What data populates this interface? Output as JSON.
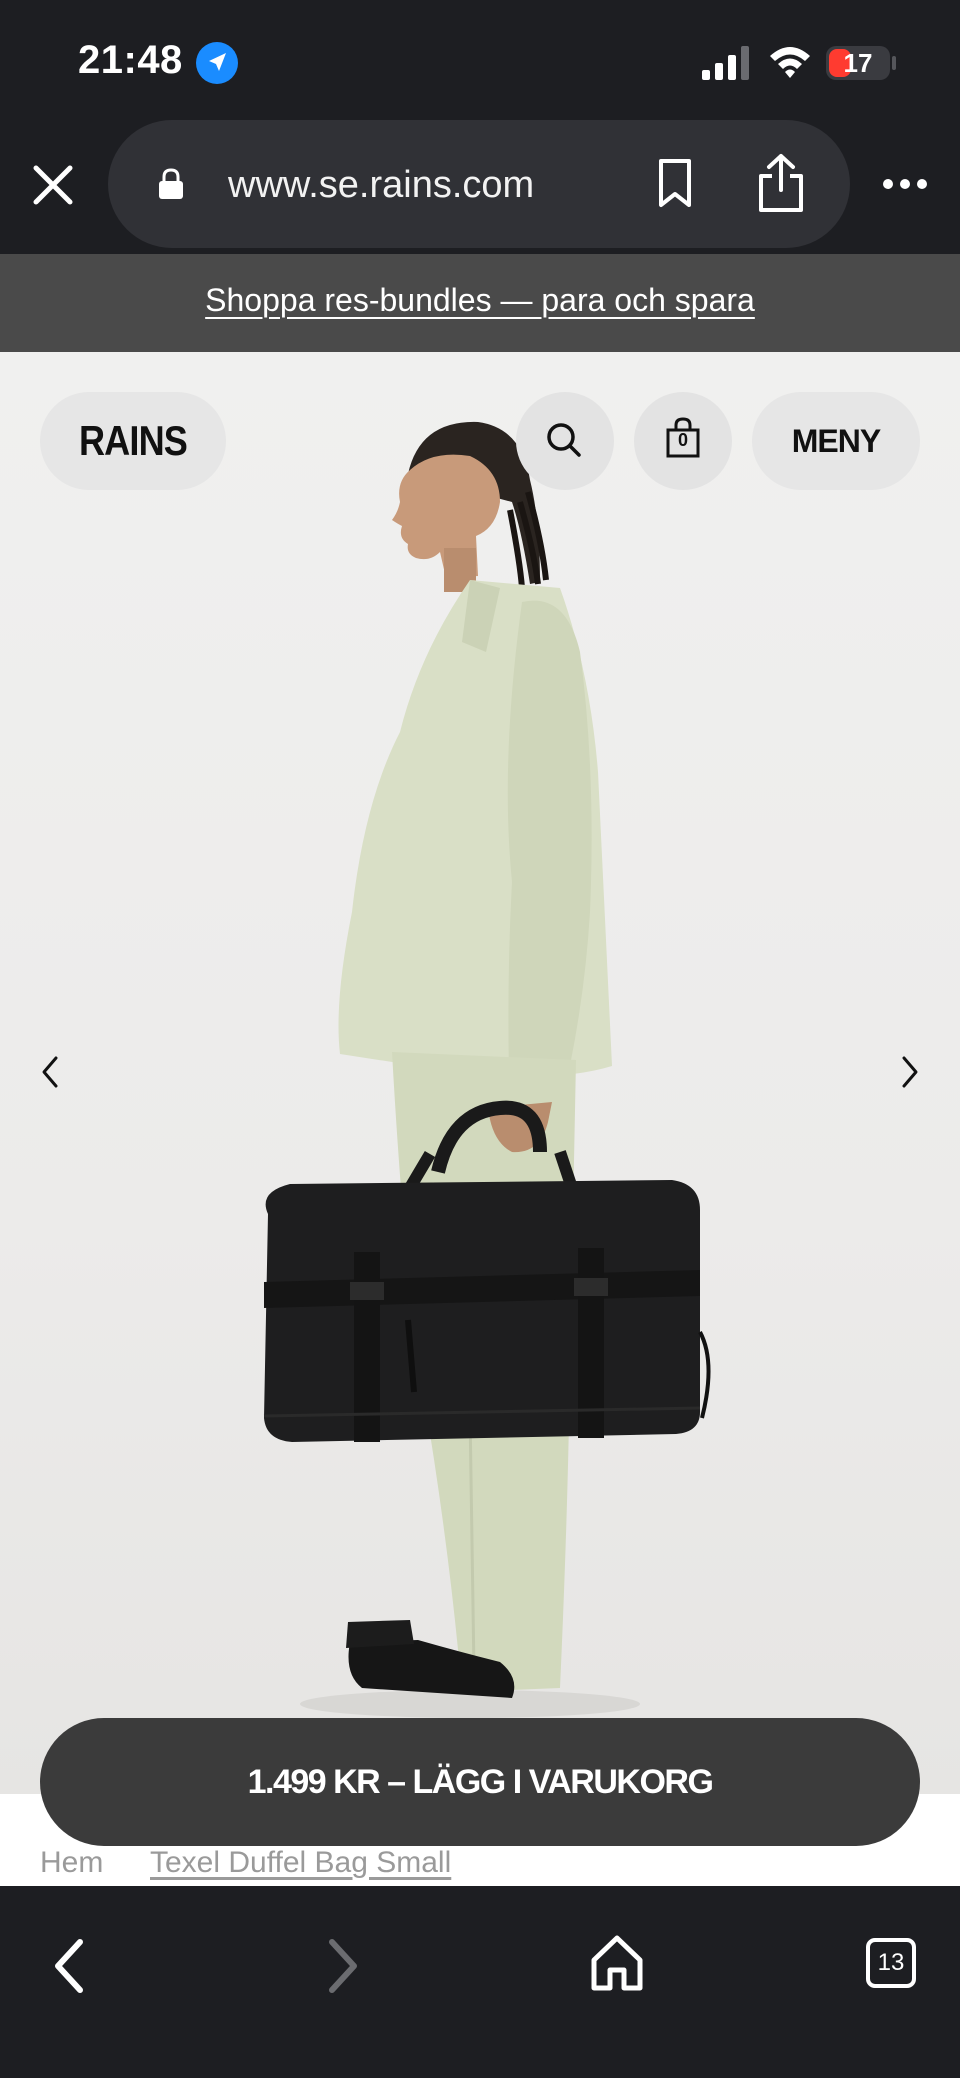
{
  "status_bar": {
    "time": "21:48",
    "battery_level": "17",
    "icons": [
      "location-arrow-icon",
      "cellular-signal-icon",
      "wifi-icon",
      "battery-icon"
    ]
  },
  "browser": {
    "url": "www.se.rains.com",
    "icons": [
      "close-icon",
      "lock-icon",
      "bookmark-icon",
      "share-icon",
      "more-icon"
    ]
  },
  "promo": {
    "text": "Shoppa res-bundles — para och spara"
  },
  "header": {
    "logo": "RAINS",
    "cart_count": "0",
    "menu_label": "MENY",
    "icons": [
      "search-icon",
      "shopping-bag-icon"
    ]
  },
  "gallery": {
    "icons": [
      "chevron-left-icon",
      "chevron-right-icon"
    ]
  },
  "cta": {
    "label": "1.499 KR – LÄGG I VARUKORG"
  },
  "breadcrumb": {
    "home": "Hem",
    "current": "Texel Duffel Bag Small"
  },
  "toolbar": {
    "tabs_count": "13",
    "icons": [
      "back-icon",
      "forward-icon",
      "home-icon",
      "tabs-icon"
    ]
  },
  "colors": {
    "chrome_dark": "#1d1e22",
    "url_pill": "#303136",
    "promo_bg": "#4a4a4a",
    "cta_bg": "#3b3b3b",
    "location_blue": "#1a8cff",
    "battery_red": "#ff3b30"
  }
}
